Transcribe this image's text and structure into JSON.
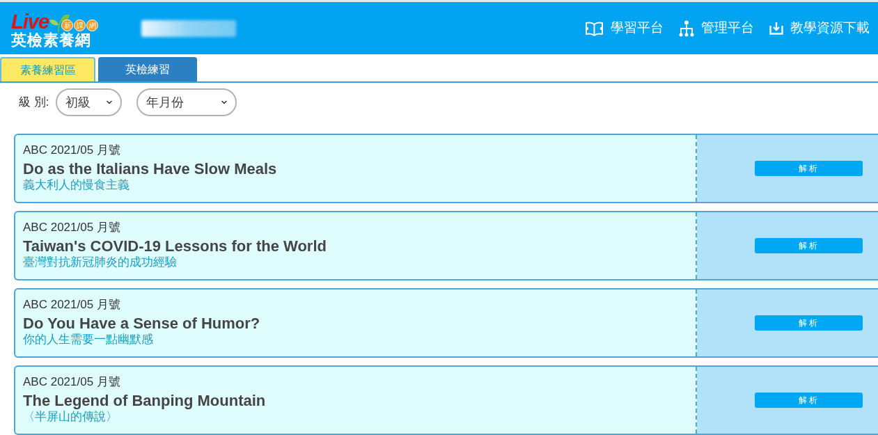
{
  "header": {
    "logo": {
      "wordmark": "Live",
      "badges": [
        "新",
        "課",
        "網"
      ],
      "name": "英檢素養網"
    },
    "nav_links": [
      {
        "label": "學習平台"
      },
      {
        "label": "管理平台"
      },
      {
        "label": "教學資源下載"
      }
    ]
  },
  "tabs": [
    {
      "label": "素養練習區",
      "selected": true
    },
    {
      "label": "英檢練習",
      "selected": false
    }
  ],
  "filters": {
    "label": "級 別:",
    "selects": [
      {
        "value": "初級"
      },
      {
        "value": "年月份"
      }
    ]
  },
  "articles": [
    {
      "issue": "ABC 2021/05 月號",
      "title": "Do as the Italians Have Slow Meals",
      "subtitle": "義大利人的慢食主義",
      "button": "解析"
    },
    {
      "issue": "ABC 2021/05 月號",
      "title": "Taiwan's COVID-19 Lessons for the World",
      "subtitle": "臺灣對抗新冠肺炎的成功經驗",
      "button": "解析"
    },
    {
      "issue": "ABC 2021/05 月號",
      "title": "Do You Have a Sense of Humor?",
      "subtitle": "你的人生需要一點幽默感",
      "button": "解析"
    },
    {
      "issue": "ABC 2021/05 月號",
      "title": "The Legend of Banping Mountain",
      "subtitle": "〈半屏山的傳說〉",
      "button": "解析"
    }
  ]
}
